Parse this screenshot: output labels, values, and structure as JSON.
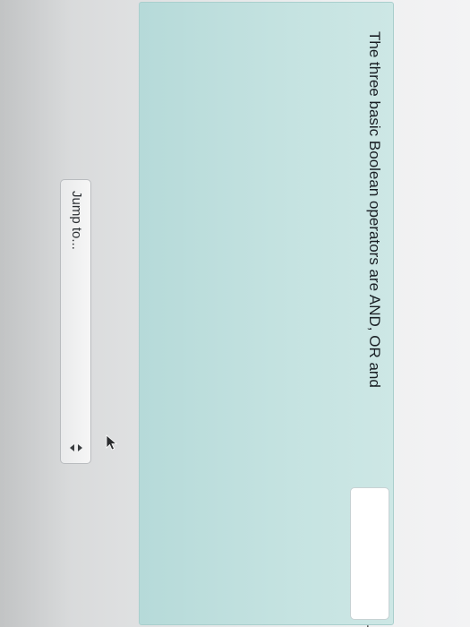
{
  "question": {
    "text": "The three basic Boolean operators are AND, OR and",
    "answer_value": "",
    "trailing_text": "."
  },
  "navigation": {
    "jump_label": "Jump to..."
  },
  "colors": {
    "panel_background": "#c5e3e1",
    "page_background": "#ececec"
  },
  "icons": {
    "select_arrows": "up-down-arrows-icon",
    "cursor": "mouse-pointer-icon"
  }
}
